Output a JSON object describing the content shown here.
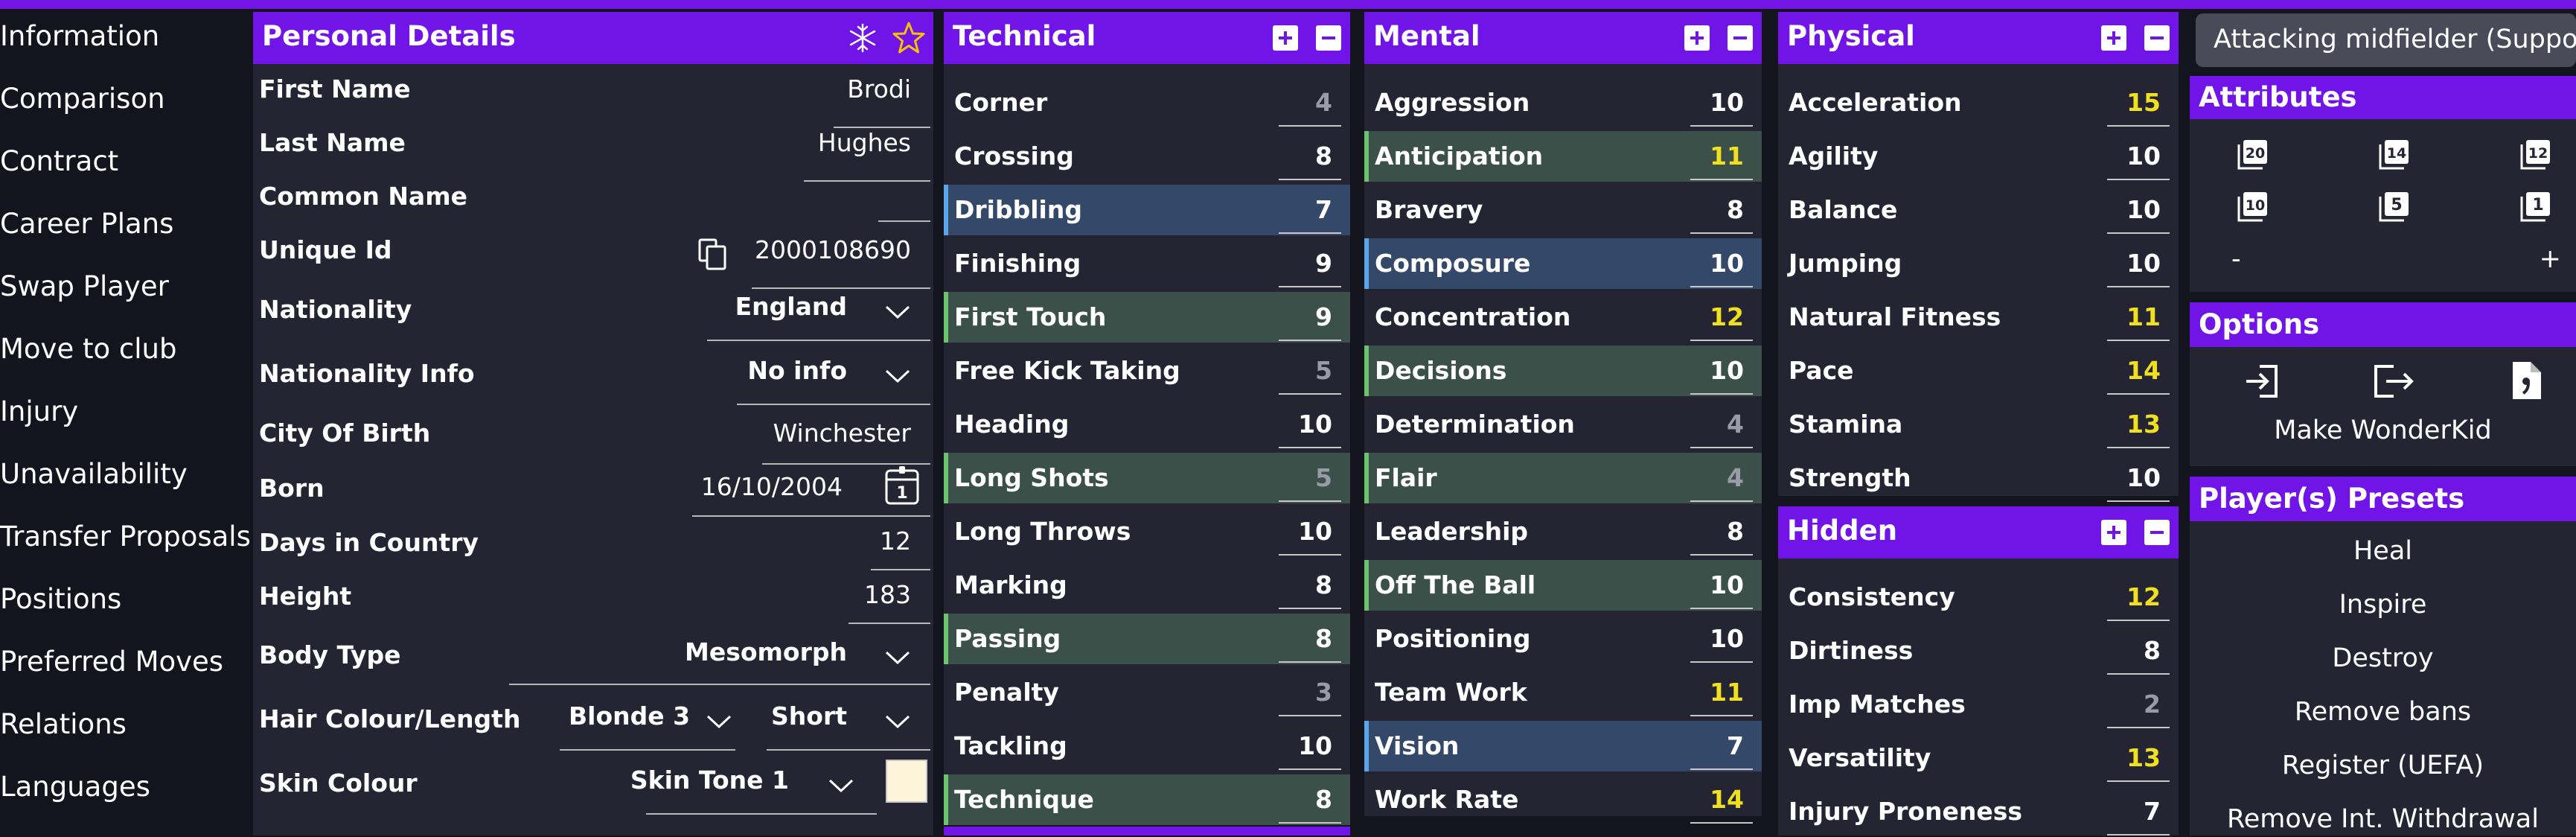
{
  "nav": [
    "Information",
    "Comparison",
    "Contract",
    "Career Plans",
    "Swap Player",
    "Move to club",
    "Injury",
    "Unavailability",
    "Transfer Proposals",
    "Positions",
    "Preferred Moves",
    "Relations",
    "Languages"
  ],
  "personal": {
    "title": "Personal Details",
    "fields": {
      "first_name": {
        "label": "First Name",
        "value": "Brodi"
      },
      "last_name": {
        "label": "Last Name",
        "value": "Hughes"
      },
      "common_name": {
        "label": "Common Name",
        "value": ""
      },
      "unique_id": {
        "label": "Unique Id",
        "value": "2000108690"
      },
      "nationality": {
        "label": "Nationality",
        "value": "England"
      },
      "nationality_info": {
        "label": "Nationality Info",
        "value": "No info"
      },
      "city_of_birth": {
        "label": "City Of Birth",
        "value": "Winchester"
      },
      "born": {
        "label": "Born",
        "value": "16/10/2004"
      },
      "days_in_country": {
        "label": "Days in Country",
        "value": "12"
      },
      "height": {
        "label": "Height",
        "value": "183"
      },
      "body_type": {
        "label": "Body Type",
        "value": "Mesomorph"
      },
      "hair": {
        "label": "Hair Colour/Length",
        "colour": "Blonde 3",
        "length": "Short"
      },
      "skin": {
        "label": "Skin Colour",
        "value": "Skin Tone 1",
        "swatch": "#fdf4dc"
      }
    }
  },
  "colors": {
    "white": "#ffffff",
    "yellow": "#f0e020",
    "grey": "#9a9aa8",
    "accent": "#7014e8"
  },
  "technical": {
    "title": "Technical",
    "rows": [
      {
        "label": "Corner",
        "value": "4",
        "tone": "grey",
        "hl": ""
      },
      {
        "label": "Crossing",
        "value": "8",
        "tone": "white",
        "hl": ""
      },
      {
        "label": "Dribbling",
        "value": "7",
        "tone": "white",
        "hl": "blue"
      },
      {
        "label": "Finishing",
        "value": "9",
        "tone": "white",
        "hl": ""
      },
      {
        "label": "First Touch",
        "value": "9",
        "tone": "white",
        "hl": "green"
      },
      {
        "label": "Free Kick Taking",
        "value": "5",
        "tone": "grey",
        "hl": ""
      },
      {
        "label": "Heading",
        "value": "10",
        "tone": "white",
        "hl": ""
      },
      {
        "label": "Long Shots",
        "value": "5",
        "tone": "grey",
        "hl": "green"
      },
      {
        "label": "Long Throws",
        "value": "10",
        "tone": "white",
        "hl": ""
      },
      {
        "label": "Marking",
        "value": "8",
        "tone": "white",
        "hl": ""
      },
      {
        "label": "Passing",
        "value": "8",
        "tone": "white",
        "hl": "green"
      },
      {
        "label": "Penalty",
        "value": "3",
        "tone": "grey",
        "hl": ""
      },
      {
        "label": "Tackling",
        "value": "10",
        "tone": "white",
        "hl": ""
      },
      {
        "label": "Technique",
        "value": "8",
        "tone": "white",
        "hl": "green"
      }
    ]
  },
  "mental": {
    "title": "Mental",
    "rows": [
      {
        "label": "Aggression",
        "value": "10",
        "tone": "white",
        "hl": ""
      },
      {
        "label": "Anticipation",
        "value": "11",
        "tone": "yellow",
        "hl": "green"
      },
      {
        "label": "Bravery",
        "value": "8",
        "tone": "white",
        "hl": ""
      },
      {
        "label": "Composure",
        "value": "10",
        "tone": "white",
        "hl": "blue"
      },
      {
        "label": "Concentration",
        "value": "12",
        "tone": "yellow",
        "hl": ""
      },
      {
        "label": "Decisions",
        "value": "10",
        "tone": "white",
        "hl": "green"
      },
      {
        "label": "Determination",
        "value": "4",
        "tone": "grey",
        "hl": ""
      },
      {
        "label": "Flair",
        "value": "4",
        "tone": "grey",
        "hl": "green"
      },
      {
        "label": "Leadership",
        "value": "8",
        "tone": "white",
        "hl": ""
      },
      {
        "label": "Off The Ball",
        "value": "10",
        "tone": "white",
        "hl": "green"
      },
      {
        "label": "Positioning",
        "value": "10",
        "tone": "white",
        "hl": ""
      },
      {
        "label": "Team Work",
        "value": "11",
        "tone": "yellow",
        "hl": ""
      },
      {
        "label": "Vision",
        "value": "7",
        "tone": "white",
        "hl": "blue"
      },
      {
        "label": "Work Rate",
        "value": "14",
        "tone": "yellow",
        "hl": ""
      }
    ]
  },
  "physical": {
    "title": "Physical",
    "rows": [
      {
        "label": "Acceleration",
        "value": "15",
        "tone": "yellow",
        "hl": ""
      },
      {
        "label": "Agility",
        "value": "10",
        "tone": "white",
        "hl": ""
      },
      {
        "label": "Balance",
        "value": "10",
        "tone": "white",
        "hl": ""
      },
      {
        "label": "Jumping",
        "value": "10",
        "tone": "white",
        "hl": ""
      },
      {
        "label": "Natural Fitness",
        "value": "11",
        "tone": "yellow",
        "hl": ""
      },
      {
        "label": "Pace",
        "value": "14",
        "tone": "yellow",
        "hl": ""
      },
      {
        "label": "Stamina",
        "value": "13",
        "tone": "yellow",
        "hl": ""
      },
      {
        "label": "Strength",
        "value": "10",
        "tone": "white",
        "hl": ""
      }
    ]
  },
  "hidden": {
    "title": "Hidden",
    "rows": [
      {
        "label": "Consistency",
        "value": "12",
        "tone": "yellow",
        "hl": ""
      },
      {
        "label": "Dirtiness",
        "value": "8",
        "tone": "white",
        "hl": ""
      },
      {
        "label": "Imp Matches",
        "value": "2",
        "tone": "grey",
        "hl": ""
      },
      {
        "label": "Versatility",
        "value": "13",
        "tone": "yellow",
        "hl": ""
      },
      {
        "label": "Injury Proneness",
        "value": "7",
        "tone": "white",
        "hl": ""
      }
    ]
  },
  "role": "Attacking midfielder (Support)",
  "attributes_panel": {
    "title": "Attributes",
    "presets": [
      "20",
      "14",
      "12",
      "10",
      "5",
      "1"
    ],
    "minus": "-",
    "plus": "+"
  },
  "options": {
    "title": "Options",
    "wonderkid": "Make WonderKid"
  },
  "player_presets": {
    "title": "Player(s) Presets",
    "items": [
      "Heal",
      "Inspire",
      "Destroy",
      "Remove bans",
      "Register (UEFA)",
      "Remove Int. Withdrawal"
    ]
  }
}
